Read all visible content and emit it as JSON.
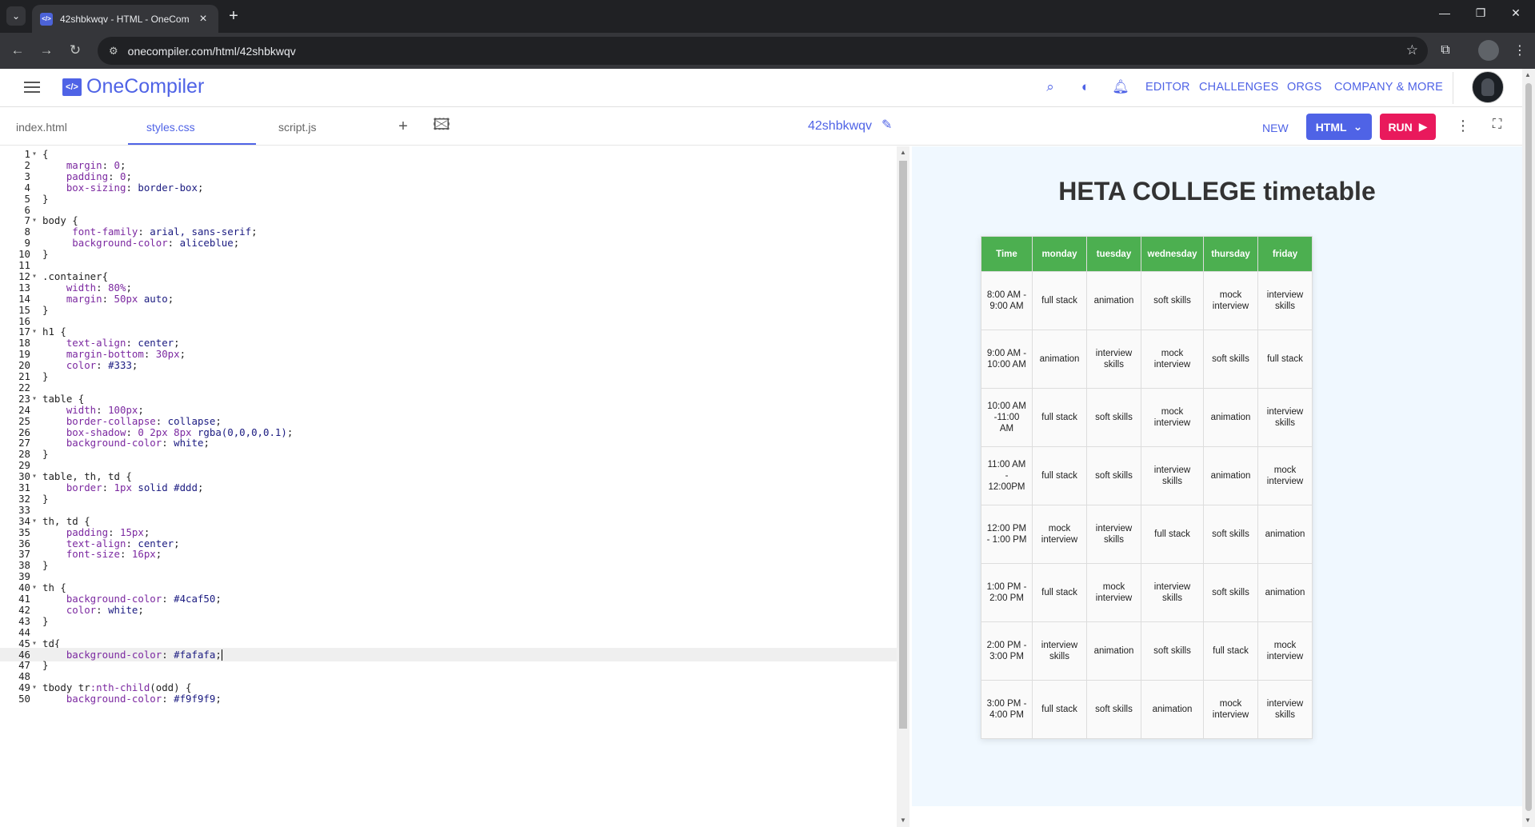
{
  "browser": {
    "tab_title": "42shbkwqv - HTML - OneCompiler",
    "url": "onecompiler.com/html/42shbkwqv"
  },
  "header": {
    "brand": "OneCompiler",
    "links": [
      "EDITOR",
      "CHALLENGES",
      "ORGS",
      "COMPANY & MORE"
    ]
  },
  "filebar": {
    "tabs": [
      "index.html",
      "styles.css",
      "script.js"
    ],
    "active_tab": "styles.css",
    "project_name": "42shbkwqv",
    "new_label": "NEW",
    "language_label": "HTML",
    "run_label": "RUN"
  },
  "editor": {
    "lines": [
      [
        [
          "t-sel",
          "{"
        ]
      ],
      [
        [
          "t-prop",
          "    margin"
        ],
        [
          "t-sel",
          ": "
        ],
        [
          "t-num",
          "0"
        ],
        [
          "t-sel",
          ";"
        ]
      ],
      [
        [
          "t-prop",
          "    padding"
        ],
        [
          "t-sel",
          ": "
        ],
        [
          "t-num",
          "0"
        ],
        [
          "t-sel",
          ";"
        ]
      ],
      [
        [
          "t-prop",
          "    box-sizing"
        ],
        [
          "t-sel",
          ": "
        ],
        [
          "t-val",
          "border-box"
        ],
        [
          "t-sel",
          ";"
        ]
      ],
      [
        [
          "t-sel",
          "}"
        ]
      ],
      [],
      [
        [
          "t-sel",
          "body {"
        ]
      ],
      [
        [
          "t-prop",
          "     font-family"
        ],
        [
          "t-sel",
          ": "
        ],
        [
          "t-val",
          "arial, sans-serif"
        ],
        [
          "t-sel",
          ";"
        ]
      ],
      [
        [
          "t-prop",
          "     background-color"
        ],
        [
          "t-sel",
          ": "
        ],
        [
          "t-val",
          "aliceblue"
        ],
        [
          "t-sel",
          ";"
        ]
      ],
      [
        [
          "t-sel",
          "}"
        ]
      ],
      [],
      [
        [
          "t-sel",
          ".container{"
        ]
      ],
      [
        [
          "t-prop",
          "    width"
        ],
        [
          "t-sel",
          ": "
        ],
        [
          "t-num",
          "80%"
        ],
        [
          "t-sel",
          ";"
        ]
      ],
      [
        [
          "t-prop",
          "    margin"
        ],
        [
          "t-sel",
          ": "
        ],
        [
          "t-num",
          "50px"
        ],
        [
          "t-val",
          " auto"
        ],
        [
          "t-sel",
          ";"
        ]
      ],
      [
        [
          "t-sel",
          "}"
        ]
      ],
      [],
      [
        [
          "t-sel",
          "h1 {"
        ]
      ],
      [
        [
          "t-prop",
          "    text-align"
        ],
        [
          "t-sel",
          ": "
        ],
        [
          "t-val",
          "center"
        ],
        [
          "t-sel",
          ";"
        ]
      ],
      [
        [
          "t-prop",
          "    margin-bottom"
        ],
        [
          "t-sel",
          ": "
        ],
        [
          "t-num",
          "30px"
        ],
        [
          "t-sel",
          ";"
        ]
      ],
      [
        [
          "t-prop",
          "    color"
        ],
        [
          "t-sel",
          ": "
        ],
        [
          "t-val",
          "#333"
        ],
        [
          "t-sel",
          ";"
        ]
      ],
      [
        [
          "t-sel",
          "}"
        ]
      ],
      [],
      [
        [
          "t-sel",
          "table {"
        ]
      ],
      [
        [
          "t-prop",
          "    width"
        ],
        [
          "t-sel",
          ": "
        ],
        [
          "t-num",
          "100px"
        ],
        [
          "t-sel",
          ";"
        ]
      ],
      [
        [
          "t-prop",
          "    border-collapse"
        ],
        [
          "t-sel",
          ": "
        ],
        [
          "t-val",
          "collapse"
        ],
        [
          "t-sel",
          ";"
        ]
      ],
      [
        [
          "t-prop",
          "    box-shadow"
        ],
        [
          "t-sel",
          ": "
        ],
        [
          "t-num",
          "0 2px 8px"
        ],
        [
          "t-val",
          " rgba(0,0,0,0.1)"
        ],
        [
          "t-sel",
          ";"
        ]
      ],
      [
        [
          "t-prop",
          "    background-color"
        ],
        [
          "t-sel",
          ": "
        ],
        [
          "t-val",
          "white"
        ],
        [
          "t-sel",
          ";"
        ]
      ],
      [
        [
          "t-sel",
          "}"
        ]
      ],
      [],
      [
        [
          "t-sel",
          "table, th, td {"
        ]
      ],
      [
        [
          "t-prop",
          "    border"
        ],
        [
          "t-sel",
          ": "
        ],
        [
          "t-num",
          "1px"
        ],
        [
          "t-val",
          " solid #ddd"
        ],
        [
          "t-sel",
          ";"
        ]
      ],
      [
        [
          "t-sel",
          "}"
        ]
      ],
      [],
      [
        [
          "t-sel",
          "th, td {"
        ]
      ],
      [
        [
          "t-prop",
          "    padding"
        ],
        [
          "t-sel",
          ": "
        ],
        [
          "t-num",
          "15px"
        ],
        [
          "t-sel",
          ";"
        ]
      ],
      [
        [
          "t-prop",
          "    text-align"
        ],
        [
          "t-sel",
          ": "
        ],
        [
          "t-val",
          "center"
        ],
        [
          "t-sel",
          ";"
        ]
      ],
      [
        [
          "t-prop",
          "    font-size"
        ],
        [
          "t-sel",
          ": "
        ],
        [
          "t-num",
          "16px"
        ],
        [
          "t-sel",
          ";"
        ]
      ],
      [
        [
          "t-sel",
          "}"
        ]
      ],
      [],
      [
        [
          "t-sel",
          "th {"
        ]
      ],
      [
        [
          "t-prop",
          "    background-color"
        ],
        [
          "t-sel",
          ": "
        ],
        [
          "t-val",
          "#4caf50"
        ],
        [
          "t-sel",
          ";"
        ]
      ],
      [
        [
          "t-prop",
          "    color"
        ],
        [
          "t-sel",
          ": "
        ],
        [
          "t-val",
          "white"
        ],
        [
          "t-sel",
          ";"
        ]
      ],
      [
        [
          "t-sel",
          "}"
        ]
      ],
      [],
      [
        [
          "t-sel",
          "td{"
        ]
      ],
      [
        [
          "t-prop",
          "    background-color"
        ],
        [
          "t-sel",
          ": "
        ],
        [
          "t-val",
          "#fafafa"
        ],
        [
          "t-sel",
          ";"
        ]
      ],
      [
        [
          "t-sel",
          "}"
        ]
      ],
      [],
      [
        [
          "t-sel",
          "tbody tr"
        ],
        [
          "t-prop",
          ":nth-child"
        ],
        [
          "t-sel",
          "(odd) {"
        ]
      ],
      [
        [
          "t-prop",
          "    background-color"
        ],
        [
          "t-sel",
          ": "
        ],
        [
          "t-val",
          "#f9f9f9"
        ],
        [
          "t-sel",
          ";"
        ]
      ]
    ],
    "fold_lines": [
      1,
      7,
      12,
      17,
      23,
      30,
      34,
      40,
      45,
      49
    ],
    "active_line": 46
  },
  "preview": {
    "title": "HETA COLLEGE timetable",
    "headers": [
      "Time",
      "monday",
      "tuesday",
      "wednesday",
      "thursday",
      "friday"
    ],
    "rows": [
      [
        "8:00 AM - 9:00 AM",
        "full stack",
        "animation",
        "soft skills",
        "mock interview",
        "interview skills"
      ],
      [
        "9:00 AM - 10:00 AM",
        "animation",
        "interview skills",
        "mock interview",
        "soft skills",
        "full stack"
      ],
      [
        "10:00 AM -11:00 AM",
        "full stack",
        "soft skills",
        "mock interview",
        "animation",
        "interview skills"
      ],
      [
        "11:00 AM - 12:00PM",
        "full stack",
        "soft skills",
        "interview skills",
        "animation",
        "mock interview"
      ],
      [
        "12:00 PM - 1:00 PM",
        "mock interview",
        "interview skills",
        "full stack",
        "soft skills",
        "animation"
      ],
      [
        "1:00 PM - 2:00 PM",
        "full stack",
        "mock interview",
        "interview skills",
        "soft skills",
        "animation"
      ],
      [
        "2:00 PM - 3:00 PM",
        "interview skills",
        "animation",
        "soft skills",
        "full stack",
        "mock interview"
      ],
      [
        "3:00 PM - 4:00 PM",
        "full stack",
        "soft skills",
        "animation",
        "mock interview",
        "interview skills"
      ]
    ]
  },
  "icons": {
    "tab_menu": "chevron-down-icon",
    "back": "arrow-left-icon",
    "forward": "arrow-right-icon",
    "reload": "reload-icon",
    "site_info": "site-info-icon",
    "bookmark": "star-icon",
    "extensions": "puzzle-icon",
    "header": [
      "search-icon",
      "theme-icon",
      "bell-icon"
    ],
    "file_actions": [
      "plus-icon",
      "add-image-icon"
    ]
  },
  "colors": {
    "accent": "#4f63e6",
    "run": "#e9195c",
    "th_background": "#4caf50",
    "preview_background": "#f0f8ff"
  }
}
